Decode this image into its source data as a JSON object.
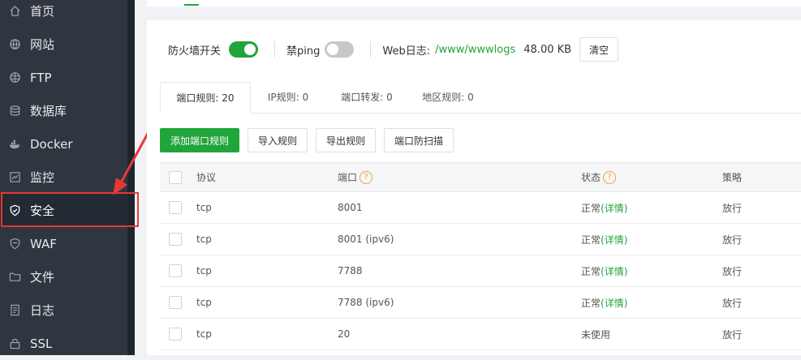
{
  "sidebar": {
    "items": [
      {
        "label": "首页",
        "icon": "home-icon"
      },
      {
        "label": "网站",
        "icon": "globe-icon"
      },
      {
        "label": "FTP",
        "icon": "ftp-icon"
      },
      {
        "label": "数据库",
        "icon": "database-icon"
      },
      {
        "label": "Docker",
        "icon": "docker-icon"
      },
      {
        "label": "监控",
        "icon": "monitor-icon"
      },
      {
        "label": "安全",
        "icon": "shield-icon",
        "active": true
      },
      {
        "label": "WAF",
        "icon": "waf-icon"
      },
      {
        "label": "文件",
        "icon": "folder-icon"
      },
      {
        "label": "日志",
        "icon": "log-icon"
      },
      {
        "label": "SSL",
        "icon": "ssl-icon"
      }
    ]
  },
  "firewall": {
    "switch_label": "防火墙开关",
    "ping_label": "禁ping",
    "web_log_label": "Web日志:",
    "web_log_path": "/www/wwwlogs",
    "web_log_size": "48.00 KB",
    "clear_label": "清空",
    "firewall_on": true,
    "ping_on": false
  },
  "tabs": [
    {
      "label": "端口规则: 20",
      "active": true
    },
    {
      "label": "IP规则: 0"
    },
    {
      "label": "端口转发: 0"
    },
    {
      "label": "地区规则: 0"
    }
  ],
  "actions": {
    "add": "添加端口规则",
    "import": "导入规则",
    "export": "导出规则",
    "scan": "端口防扫描"
  },
  "table": {
    "headers": {
      "protocol": "协议",
      "port": "端口",
      "status": "状态",
      "policy": "策略"
    },
    "help": "?",
    "rows": [
      {
        "protocol": "tcp",
        "port": "8001",
        "status": "正常",
        "detail": "(详情)",
        "policy": "放行"
      },
      {
        "protocol": "tcp",
        "port": "8001 (ipv6)",
        "status": "正常",
        "detail": "(详情)",
        "policy": "放行"
      },
      {
        "protocol": "tcp",
        "port": "7788",
        "status": "正常",
        "detail": "(详情)",
        "policy": "放行"
      },
      {
        "protocol": "tcp",
        "port": "7788 (ipv6)",
        "status": "正常",
        "detail": "(详情)",
        "policy": "放行"
      },
      {
        "protocol": "tcp",
        "port": "20",
        "status": "未使用",
        "detail": "",
        "policy": "放行"
      }
    ]
  },
  "colors": {
    "accent": "#20a53a",
    "sidebar": "#2f3640",
    "highlight": "#e53935"
  }
}
